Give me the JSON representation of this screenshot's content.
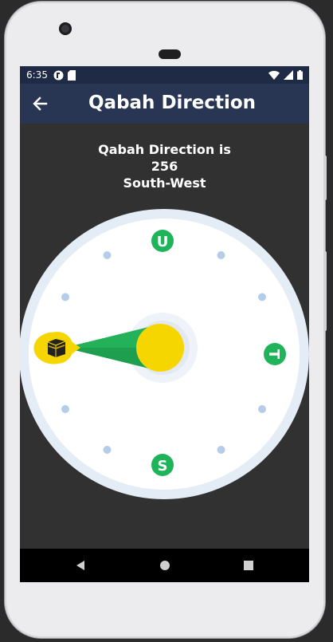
{
  "statusbar": {
    "time": "6:35"
  },
  "appbar": {
    "title": "Qabah Direction"
  },
  "info": {
    "label": "Qabah Direction is",
    "degrees": "256",
    "direction": "South-West"
  },
  "compass": {
    "markers": {
      "north": "U",
      "east": "T",
      "south": "S"
    },
    "colors": {
      "marker": "#1fb45a",
      "needle": "#1e9e4f",
      "kaaba": "#f6d600",
      "dial_ring": "#e4ecf6",
      "dot": "#b5cde9"
    }
  },
  "navbar": {
    "back": "back-icon",
    "home": "home-icon",
    "recents": "recents-icon"
  }
}
